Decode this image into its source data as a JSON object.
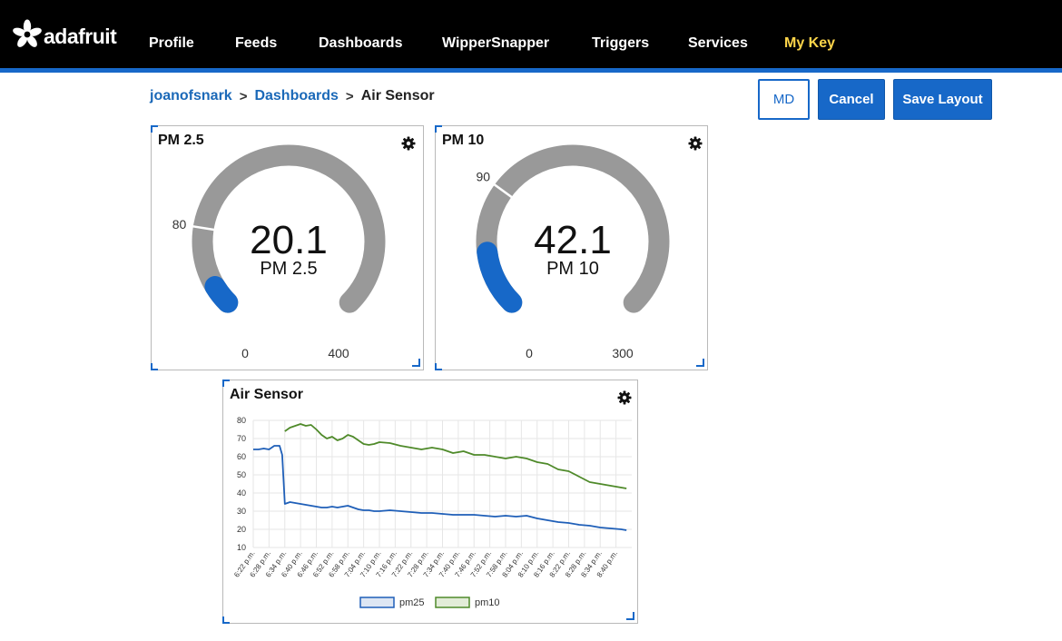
{
  "nav": {
    "logo_text": "adafruit",
    "items": [
      {
        "label": "Profile"
      },
      {
        "label": "Feeds"
      },
      {
        "label": "Dashboards"
      },
      {
        "label": "WipperSnapper"
      },
      {
        "label": "Triggers"
      },
      {
        "label": "Services"
      },
      {
        "label": "My Key"
      }
    ],
    "accent_color": "#ffd64a",
    "stripe_color": "#1768c8"
  },
  "breadcrumb": {
    "user": "joanofsnark",
    "section": "Dashboards",
    "current": "Air Sensor",
    "separator": ">"
  },
  "toolbar": {
    "size_label": "MD",
    "cancel_label": "Cancel",
    "save_label": "Save Layout"
  },
  "gauges": [
    {
      "title": "PM 2.5",
      "value": "20.1",
      "value_num": 20.1,
      "label": "PM 2.5",
      "min": 0,
      "max": 400,
      "min_label": "0",
      "max_label": "400",
      "threshold": 80,
      "threshold_label": "80",
      "fill_color": "#1768c8",
      "track_color": "#999999"
    },
    {
      "title": "PM 10",
      "value": "42.1",
      "value_num": 42.1,
      "label": "PM 10",
      "min": 0,
      "max": 300,
      "min_label": "0",
      "max_label": "300",
      "threshold": 90,
      "threshold_label": "90",
      "fill_color": "#1768c8",
      "track_color": "#999999"
    }
  ],
  "chart_panel": {
    "title": "Air Sensor"
  },
  "chart_data": {
    "type": "line",
    "title": "Air Sensor",
    "xlabel": "",
    "ylabel": "",
    "ylim": [
      10,
      80
    ],
    "yticks": [
      10,
      20,
      30,
      40,
      50,
      60,
      70,
      80
    ],
    "grid": true,
    "legend_position": "bottom",
    "categories": [
      "6:22 p.m.",
      "6:28 p.m.",
      "6:34 p.m.",
      "6:40 p.m.",
      "6:46 p.m.",
      "6:52 p.m.",
      "6:58 p.m.",
      "7:04 p.m.",
      "7:10 p.m.",
      "7:16 p.m.",
      "7:22 p.m.",
      "7:28 p.m.",
      "7:34 p.m.",
      "7:40 p.m.",
      "7:46 p.m.",
      "7:52 p.m.",
      "7:58 p.m.",
      "8:04 p.m.",
      "8:10 p.m.",
      "8:16 p.m.",
      "8:22 p.m.",
      "8:28 p.m.",
      "8:34 p.m.",
      "8:40 p.m."
    ],
    "series": [
      {
        "name": "pm25",
        "color": "#1f5fb8",
        "fill": "#dde6f3",
        "x": [
          "6:22",
          "6:24",
          "6:26",
          "6:28",
          "6:30",
          "6:32",
          "6:33",
          "6:34",
          "6:36",
          "6:38",
          "6:40",
          "6:42",
          "6:44",
          "6:46",
          "6:48",
          "6:50",
          "6:52",
          "6:54",
          "6:56",
          "6:58",
          "7:00",
          "7:02",
          "7:04",
          "7:06",
          "7:08",
          "7:10",
          "7:14",
          "7:18",
          "7:22",
          "7:26",
          "7:30",
          "7:34",
          "7:38",
          "7:42",
          "7:46",
          "7:50",
          "7:54",
          "7:58",
          "8:02",
          "8:06",
          "8:10",
          "8:14",
          "8:18",
          "8:22",
          "8:26",
          "8:30",
          "8:34",
          "8:38",
          "8:42",
          "8:44"
        ],
        "y": [
          64,
          64,
          64.5,
          64,
          66,
          66,
          61,
          34,
          35,
          34.5,
          34,
          33.5,
          33,
          32.5,
          32,
          32,
          32.5,
          32,
          32.5,
          33,
          32,
          31,
          30.5,
          30.5,
          30,
          30,
          30.5,
          30,
          29.5,
          29,
          29,
          28.5,
          28,
          28,
          28,
          27.5,
          27,
          27.5,
          27,
          27.5,
          26,
          25,
          24,
          23.5,
          22.5,
          22,
          21,
          20.5,
          20,
          19.5
        ]
      },
      {
        "name": "pm10",
        "color": "#4f8a2a",
        "fill": "#e2ecd8",
        "x": [
          "6:34",
          "6:36",
          "6:38",
          "6:40",
          "6:42",
          "6:44",
          "6:46",
          "6:48",
          "6:50",
          "6:52",
          "6:54",
          "6:56",
          "6:58",
          "7:00",
          "7:02",
          "7:04",
          "7:06",
          "7:08",
          "7:10",
          "7:14",
          "7:18",
          "7:22",
          "7:26",
          "7:30",
          "7:34",
          "7:38",
          "7:42",
          "7:46",
          "7:50",
          "7:54",
          "7:58",
          "8:02",
          "8:06",
          "8:10",
          "8:14",
          "8:18",
          "8:22",
          "8:26",
          "8:30",
          "8:34",
          "8:38",
          "8:42",
          "8:44"
        ],
        "y": [
          74,
          76,
          77,
          78,
          77,
          77.5,
          75,
          72,
          70,
          71,
          69,
          70,
          72,
          71,
          69,
          67,
          66.5,
          67,
          68,
          67.5,
          66,
          65,
          64,
          65,
          64,
          62,
          63,
          61,
          61,
          60,
          59,
          60,
          59,
          57,
          56,
          53,
          52,
          49,
          46,
          45,
          44,
          43,
          42.5
        ]
      }
    ]
  }
}
